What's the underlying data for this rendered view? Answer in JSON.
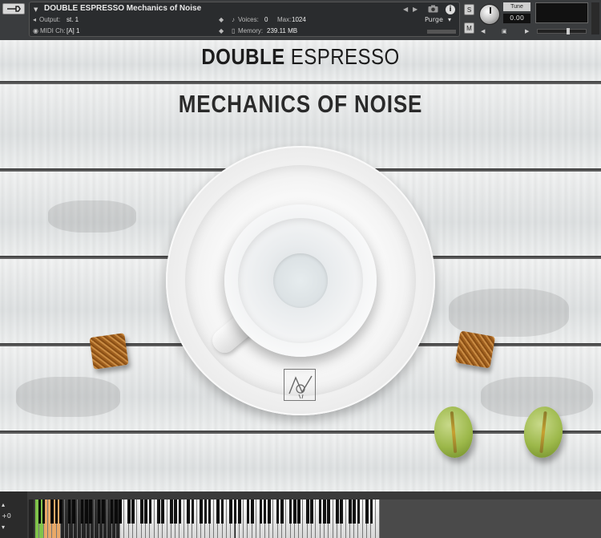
{
  "header": {
    "instrument_name": "DOUBLE ESPRESSO Mechanics of Noise",
    "output_label": "Output:",
    "output_value": "st. 1",
    "voices_label": "Voices:",
    "voices_value": "0",
    "max_label": "Max:",
    "max_value": "1024",
    "midi_label": "MIDI Ch:",
    "midi_value": "[A]  1",
    "memory_label": "Memory:",
    "memory_value": "239.11 MB",
    "purge_label": "Purge",
    "solo_label": "S",
    "mute_label": "M",
    "tune_label": "Tune",
    "tune_value": "0.00",
    "info_label": "i"
  },
  "main": {
    "title_bold": "DOUBLE",
    "title_light": "ESPRESSO",
    "subtitle": "MECHANICS OF NOISE"
  },
  "keyboard": {
    "octave_up": "+0",
    "highlight_color": "#e8a867",
    "green_color": "#7fc34a"
  },
  "icons": {
    "wrench": "wrench-icon",
    "camera": "camera-icon",
    "info": "info-icon"
  }
}
